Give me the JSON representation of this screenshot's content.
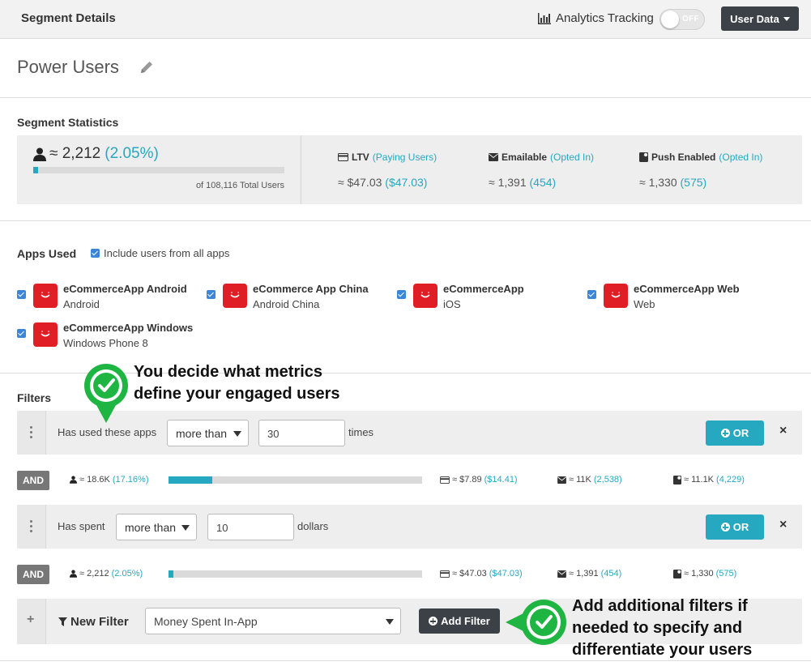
{
  "header": {
    "title": "Segment Details",
    "analytics_label": "Analytics Tracking",
    "toggle_label": "OFF",
    "user_data_label": "User Data"
  },
  "segment": {
    "name": "Power Users"
  },
  "stats": {
    "section_title": "Segment Statistics",
    "users_value": "≈ 2,212",
    "users_pct": "(2.05%)",
    "users_fill_fraction": 0.0205,
    "total_users": "of 108,116 Total Users",
    "ltv_label": "LTV",
    "ltv_sub": "(Paying Users)",
    "ltv_value": "≈ $47.03",
    "ltv_paying": "($47.03)",
    "emailable_label": "Emailable",
    "emailable_sub": "(Opted In)",
    "emailable_value": "≈ 1,391",
    "emailable_opted": "(454)",
    "push_label": "Push Enabled",
    "push_sub": "(Opted In)",
    "push_value": "≈ 1,330",
    "push_opted": "(575)"
  },
  "apps": {
    "section_title": "Apps Used",
    "include_all_label": "Include users from all apps",
    "items": [
      {
        "name": "eCommerceApp Android",
        "platform": "Android",
        "checked": true
      },
      {
        "name": "eCommerce App China",
        "platform": "Android China",
        "checked": true
      },
      {
        "name": "eCommerceApp",
        "platform": "iOS",
        "checked": true
      },
      {
        "name": "eCommerceApp Web",
        "platform": "Web",
        "checked": true
      },
      {
        "name": "eCommerceApp Windows",
        "platform": "Windows Phone 8",
        "checked": true
      }
    ]
  },
  "filters": {
    "section_title": "Filters",
    "rows": [
      {
        "label": "Has used these apps",
        "operator": "more than",
        "value": "30",
        "unit": "times",
        "or_label": "OR",
        "and_label": "AND",
        "and_stats": {
          "users": "≈ 18.6K",
          "users_pct": "(17.16%)",
          "users_fill_fraction": 0.1716,
          "ltv": "≈ $7.89",
          "ltv_paying": "($14.41)",
          "email": "≈ 11K",
          "email_opted": "(2,538)",
          "push": "≈ 11.1K",
          "push_opted": "(4,229)"
        }
      },
      {
        "label": "Has spent",
        "operator": "more than",
        "value": "10",
        "unit": "dollars",
        "or_label": "OR",
        "and_label": "AND",
        "and_stats": {
          "users": "≈ 2,212",
          "users_pct": "(2.05%)",
          "users_fill_fraction": 0.0205,
          "ltv": "≈ $47.03",
          "ltv_paying": "($47.03)",
          "email": "≈ 1,391",
          "email_opted": "(454)",
          "push": "≈ 1,330",
          "push_opted": "(575)"
        }
      }
    ],
    "new_filter_label": "New Filter",
    "new_filter_select": "Money Spent In-App",
    "add_filter_label": "Add Filter"
  },
  "callouts": {
    "top_line1": "You decide what metrics",
    "top_line2": "define your engaged users",
    "bottom_line1": "Add additional filters if",
    "bottom_line2": "needed to specify and",
    "bottom_line3": "differentiate your users"
  },
  "colors": {
    "accent": "#26a8c1",
    "dark_button": "#3b4147",
    "app_icon": "#e01e26",
    "callout_green": "#1fb543"
  }
}
